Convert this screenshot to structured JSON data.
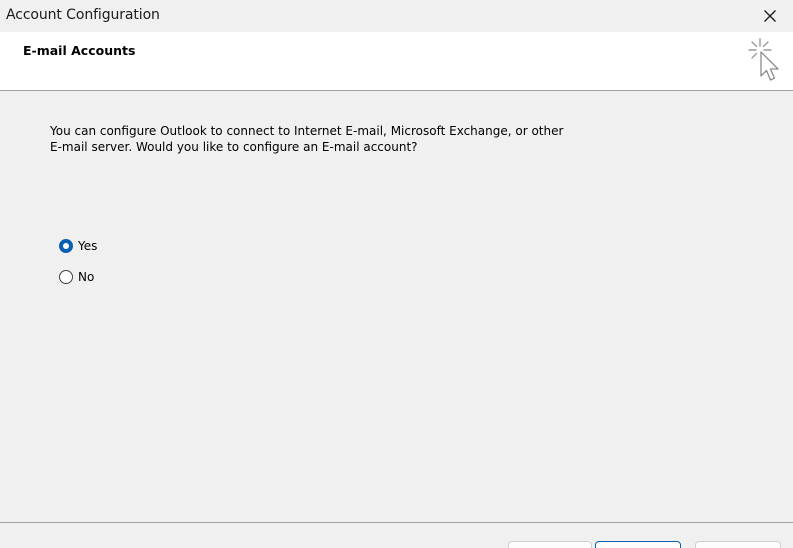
{
  "window": {
    "title": "Account Configuration"
  },
  "header": {
    "title": "E-mail Accounts",
    "icon": "cursor-sparkle-icon"
  },
  "body": {
    "description": "You can configure Outlook to connect to Internet E-mail, Microsoft Exchange, or other E-mail server. Would you like to configure an E-mail account?",
    "options": [
      {
        "label": "Yes",
        "selected": true
      },
      {
        "label": "No",
        "selected": false
      }
    ]
  },
  "colors": {
    "accent": "#0a5fb4",
    "header_bg": "#ffffff",
    "body_bg": "#f0f0f0"
  }
}
